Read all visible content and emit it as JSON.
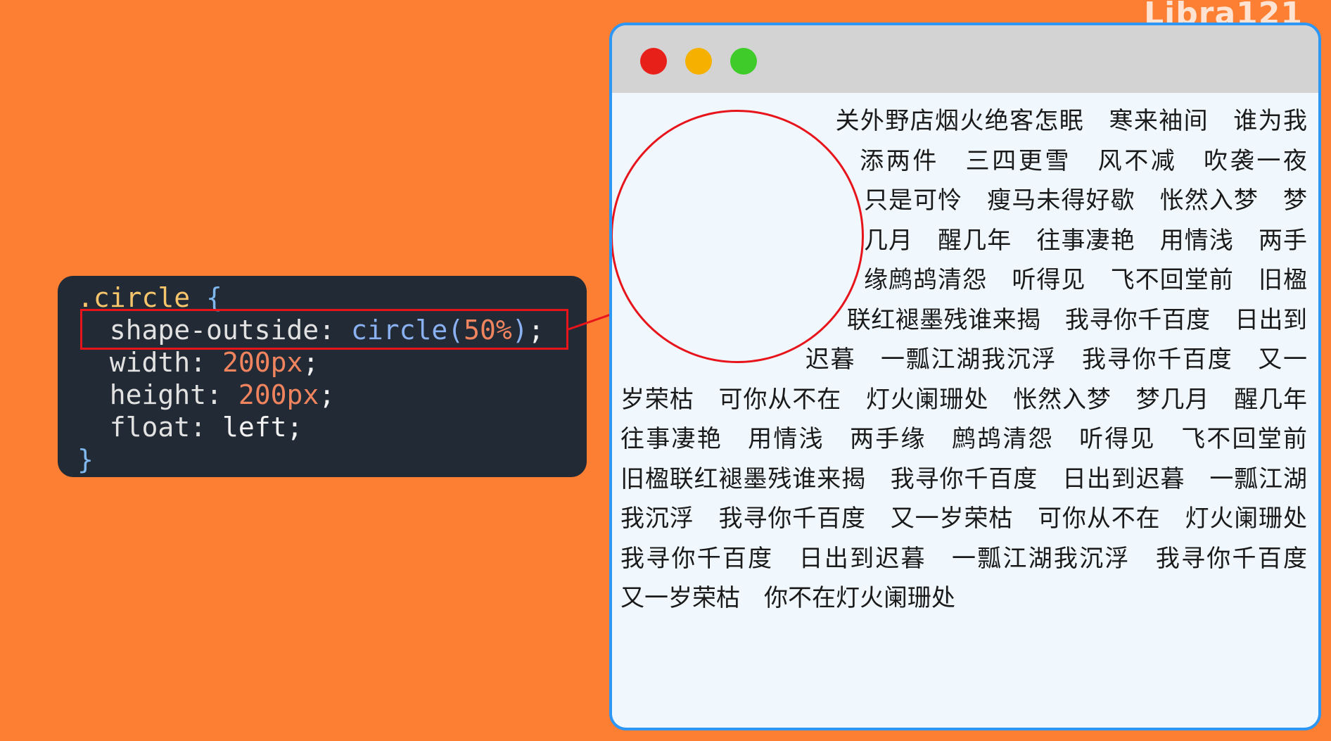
{
  "watermark": "Libra121",
  "code": {
    "line1": {
      "selector": ".circle",
      "brace_open": "{"
    },
    "line2": {
      "property": "shape-outside",
      "colon": ":",
      "function": "circle(",
      "value": "50%",
      "close": ")",
      "semicolon": ";"
    },
    "line3": {
      "property": "width",
      "colon": ":",
      "value": "200px",
      "semicolon": ";"
    },
    "line4": {
      "property": "height",
      "colon": ":",
      "value": "200px",
      "semicolon": ";"
    },
    "line5": {
      "property": "float",
      "colon": ":",
      "value": "left",
      "semicolon": ";"
    },
    "line6": {
      "brace_close": "}"
    }
  },
  "colors": {
    "background": "#fc7f33",
    "highlight": "#e8141c",
    "browser_border": "#2e97f3",
    "window_close": "#e8201a",
    "window_minimize": "#f5b000",
    "window_maximize": "#3fcc2a"
  },
  "browser": {
    "poem": "关外野店烟火绝客怎眠　寒来袖间　谁为我添两件　三四更雪　风不减　吹袭一夜　只是可怜　瘦马未得好歇　怅然入梦　梦几月　醒几年　往事凄艳　用情浅　两手缘鹧鸪清怨　听得见　飞不回堂前　旧楹联红褪墨残谁来揭　我寻你千百度　日出到迟暮　一瓢江湖我沉浮　我寻你千百度　又一岁荣枯　可你从不在　灯火阑珊处　怅然入梦　梦几月　醒几年往事凄艳　用情浅　两手缘　鹧鸪清怨　听得见　飞不回堂前　旧楹联红褪墨残谁来揭　我寻你千百度　日出到迟暮　一瓢江湖我沉浮　我寻你千百度　又一岁荣枯　可你从不在　灯火阑珊处　我寻你千百度　日出到迟暮　一瓢江湖我沉浮　我寻你千百度　又一岁荣枯　你不在灯火阑珊处"
  }
}
